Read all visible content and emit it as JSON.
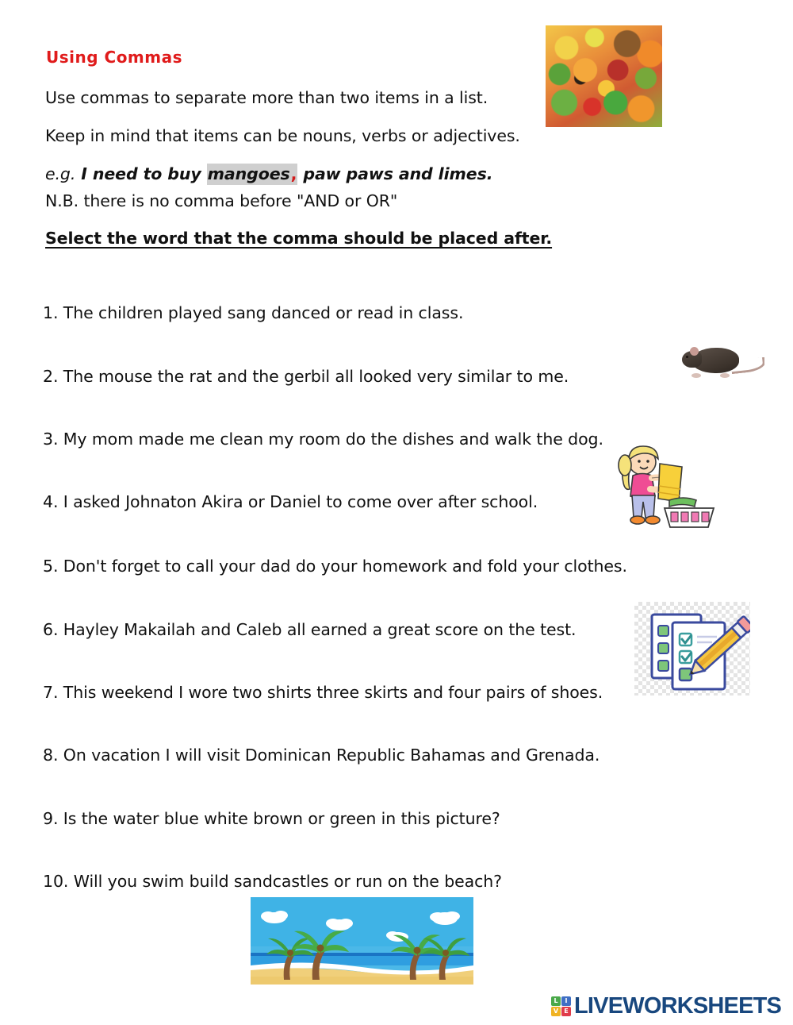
{
  "worksheet": {
    "title": "Using Commas",
    "title_color": "#e01b1b",
    "intro_line_1": "Use commas to separate more than two items in a list.",
    "intro_line_2": "Keep in mind that items can be nouns, verbs or adjectives.",
    "example": {
      "label": "e.g.",
      "before_highlight": " I need to buy ",
      "highlighted_word": "mangoes",
      "highlight_color": "#cfcfcf",
      "comma": ",",
      "comma_color": "#d21b1b",
      "after_highlight": " paw paws and limes."
    },
    "note_line": "N.B. there is no comma before \"AND or OR\"",
    "task_heading": "Select the word that the comma should be placed after."
  },
  "questions": [
    {
      "number": "1.",
      "text": "The children played sang danced or read in class."
    },
    {
      "number": "2.",
      "text": "The mouse the rat and the gerbil all looked very similar to me."
    },
    {
      "number": "3.",
      "text": "My mom made me clean my room do the dishes and walk the dog."
    },
    {
      "number": "4.",
      "text": "I asked Johnaton Akira or Daniel to come over after school."
    },
    {
      "number": "5.",
      "text": "Don't forget to call your dad do your homework and fold your clothes."
    },
    {
      "number": "6.",
      "text": "Hayley Makailah and Caleb all earned a great score on the test."
    },
    {
      "number": "7.",
      "text": "This weekend I wore two shirts three skirts and four pairs of shoes."
    },
    {
      "number": "8.",
      "text": "On vacation I will visit Dominican Republic Bahamas and Grenada."
    },
    {
      "number": "9.",
      "text": "Is the water blue white brown or green in this picture?"
    },
    {
      "number": "10.",
      "text": "Will you swim build sandcastles or run on the beach?"
    }
  ],
  "images": {
    "fruit": "tropical-fruit-photo",
    "rat": "rat-photo",
    "laundry": "girl-folding-laundry-clipart",
    "checklist": "checklist-with-pencil-clipart",
    "beach": "beach-with-palm-trees-banner"
  },
  "footer": {
    "logo_tiles": [
      "LI",
      "VE"
    ],
    "tile_letters": [
      "L",
      "I",
      "V",
      "E"
    ],
    "wordmark": "LIVEWORKSHEETS",
    "wordmark_color": "#18477e"
  }
}
